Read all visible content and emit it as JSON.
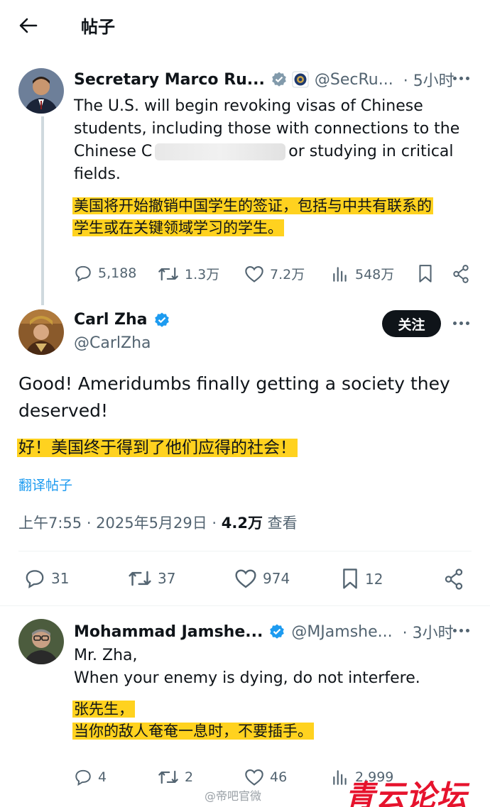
{
  "header": {
    "back_label": "←",
    "title": "帖子"
  },
  "tweet1": {
    "name": "Secretary Marco Ru...",
    "handle": "@SecRu...",
    "time": "· 5小时",
    "text_lines": [
      "The U.S. will begin revoking visas of Chinese",
      "students, including those with connections to the",
      "Chinese C",
      "or studying in critical",
      "fields."
    ],
    "translation_lines": [
      "美国将开始撤销中国学生的签证，包括与中共有联系的",
      "学生或在关键领域学习的学生。"
    ],
    "replies": "5,188",
    "retweets": "1.3万",
    "likes": "7.2万",
    "views": "548万"
  },
  "tweet2": {
    "name": "Carl Zha",
    "handle": "@CarlZha",
    "follow_label": "关注",
    "text_lines": [
      "Good! Ameridumbs finally getting a society they",
      "deserved!"
    ],
    "translation": "好！美国终于得到了他们应得的社会！",
    "translate_link": "翻译帖子",
    "meta_time": "上午7:55 · 2025年5月29日 · ",
    "meta_views": "4.2万",
    "meta_views_label": " 查看",
    "replies": "31",
    "retweets": "37",
    "likes": "974",
    "bookmarks": "12"
  },
  "tweet3": {
    "name": "Mohammad Jamshe...",
    "handle": "@MJamshe...",
    "time": "· 3小时",
    "text_lines": [
      "Mr. Zha,",
      "When your enemy is dying,  do not interfere."
    ],
    "translation_lines": [
      "张先生，",
      "当你的敌人奄奄一息时，不要插手。"
    ],
    "replies": "4",
    "retweets": "2",
    "likes": "46",
    "views": "2,999"
  },
  "watermark": "@帝吧官微",
  "brand": "青云论坛",
  "colors": {
    "highlight": "#ffd21f",
    "verified_blue": "#1d9bf0",
    "text_secondary": "#536471",
    "brand_red": "#e6132d"
  }
}
